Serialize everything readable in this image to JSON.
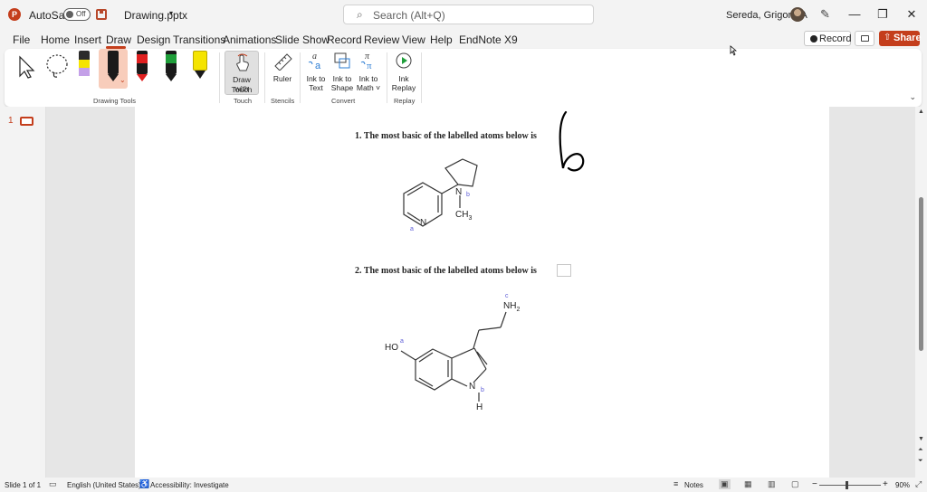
{
  "titlebar": {
    "app_logo_letter": "P",
    "autosave_label": "AutoSave",
    "autosave_state": "Off",
    "file_name": "Drawing.pptx",
    "search_placeholder": "Search (Alt+Q)",
    "user_name": "Sereda, Grigoriy A"
  },
  "menu": {
    "tabs": [
      "File",
      "Home",
      "Insert",
      "Draw",
      "Design",
      "Transitions",
      "Animations",
      "Slide Show",
      "Record",
      "Review",
      "View",
      "Help",
      "EndNote X9"
    ],
    "active": "Draw",
    "record_label": "Record",
    "share_label": "Share"
  },
  "ribbon": {
    "groups": {
      "drawing_tools": "Drawing Tools",
      "touch": "Touch",
      "stencils": "Stencils",
      "convert": "Convert",
      "replay": "Replay"
    },
    "buttons": {
      "draw_with_touch": [
        "Draw with",
        "Touch"
      ],
      "ruler": "Ruler",
      "ink_to_text": [
        "Ink to",
        "Text"
      ],
      "ink_to_shape": [
        "Ink to",
        "Shape"
      ],
      "ink_to_math": [
        "Ink to",
        "Math ˅"
      ],
      "ink_replay": [
        "Ink",
        "Replay"
      ]
    },
    "pen_colors": {
      "pen1": "#2b2b2b",
      "pen1_band": "#c4a0e8",
      "pen2": "#1a1a1a",
      "pen3": "#e02020",
      "pen4": "#1f9e3a",
      "highlighter": "#f5e400"
    }
  },
  "thumbnails": {
    "slide_number": "1"
  },
  "slide": {
    "question1": "1. The most basic of the labelled atoms below is",
    "question2": "2. The most basic of the labelled atoms below is",
    "handwritten_answer": "b",
    "mol1": {
      "n_ring": "N",
      "label_a": "a",
      "n_pyrrolidine": "N",
      "label_b": "b",
      "methyl": "CH",
      "methyl_sub": "3"
    },
    "mol2": {
      "hydroxyl": "HO",
      "label_a": "a",
      "amine": "NH",
      "amine_sub": "2",
      "label_c": "c",
      "indole_n": "N",
      "label_b": "b",
      "indole_h": "H"
    }
  },
  "status": {
    "slide_info": "Slide 1 of 1",
    "language": "English (United States)",
    "accessibility": "Accessibility: Investigate",
    "notes": "Notes",
    "zoom": "90%"
  },
  "colors": {
    "accent": "#c43e1c",
    "label_blue": "#5b5bd6"
  }
}
